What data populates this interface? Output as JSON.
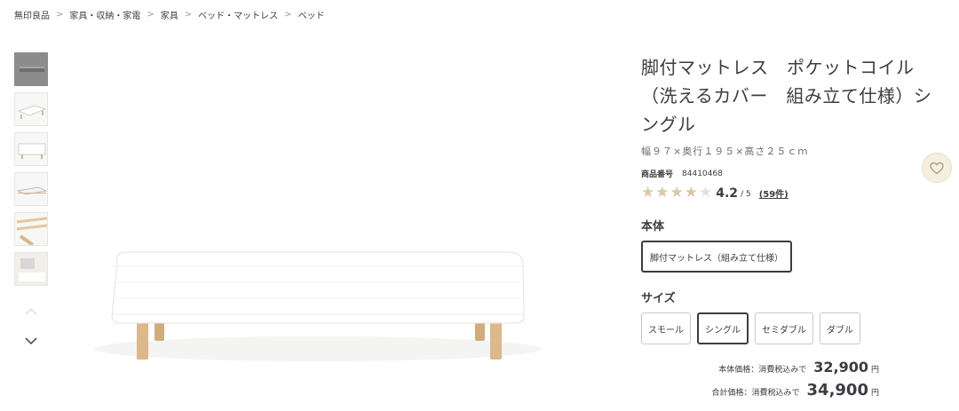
{
  "breadcrumb": [
    "無印良品",
    "家具・収納・家電",
    "家具",
    "ベッド・マットレス",
    "ベッド"
  ],
  "breadcrumb_separator": ">",
  "thumbnails": [
    {
      "name": "thumb-bed-gray"
    },
    {
      "name": "thumb-bed-angled"
    },
    {
      "name": "thumb-bed-front"
    },
    {
      "name": "thumb-bed-side"
    },
    {
      "name": "thumb-bed-legs"
    },
    {
      "name": "thumb-bed-room"
    }
  ],
  "product": {
    "title": "脚付マットレス　ポケットコイル（洗えるカバー　組み立て仕様）シングル",
    "size": "幅９７×奥行１９５×高さ２５ｃｍ",
    "code_label": "商品番号",
    "code": "84410468",
    "rating": 4.2,
    "rating_text": "4.2",
    "rating_max": "/ 5",
    "reviews": "(59件)"
  },
  "body_section": {
    "label": "本体",
    "option": "脚付マットレス（組み立て仕様）"
  },
  "size_section": {
    "label": "サイズ",
    "options": [
      "スモール",
      "シングル",
      "セミダブル",
      "ダブル"
    ],
    "selected": "シングル"
  },
  "prices": {
    "body_label": "本体価格：消費税込みで",
    "body_amount": "32,900",
    "total_label": "合計価格：消費税込みで",
    "total_amount": "34,900",
    "unit": "円"
  },
  "colors": {
    "star_filled": "#d9c8a3",
    "star_empty": "#e6e0d3",
    "favorite_bg": "#f6efe0",
    "text": "#3c3c43"
  }
}
